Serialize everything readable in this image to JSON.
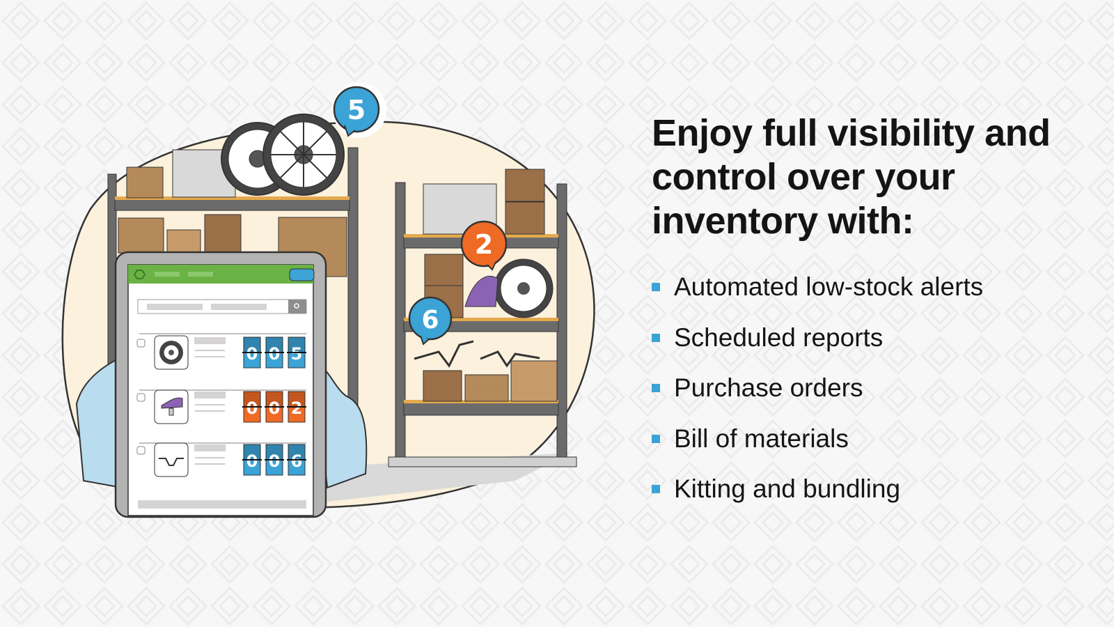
{
  "headline": "Enjoy full visibility and control over your inventory with:",
  "features": [
    {
      "label": "Automated low-stock alerts"
    },
    {
      "label": "Scheduled reports"
    },
    {
      "label": "Purchase orders"
    },
    {
      "label": "Bill of materials"
    },
    {
      "label": "Kitting and bundling"
    }
  ],
  "illustration": {
    "badges": [
      {
        "value": "5",
        "color": "#3ba3d6"
      },
      {
        "value": "2",
        "color": "#ef6a25"
      },
      {
        "value": "6",
        "color": "#3ba3d6"
      }
    ],
    "tablet_items": [
      {
        "item": "wheel",
        "count": [
          "0",
          "0",
          "5"
        ],
        "color": "#3ba3d6"
      },
      {
        "item": "seat",
        "count": [
          "0",
          "0",
          "2"
        ],
        "color": "#ef6a25"
      },
      {
        "item": "handlebar",
        "count": [
          "0",
          "0",
          "6"
        ],
        "color": "#3ba3d6"
      }
    ]
  },
  "colors": {
    "accent": "#3ba3d6",
    "alert": "#ef6a25",
    "app_header": "#6ab245"
  }
}
